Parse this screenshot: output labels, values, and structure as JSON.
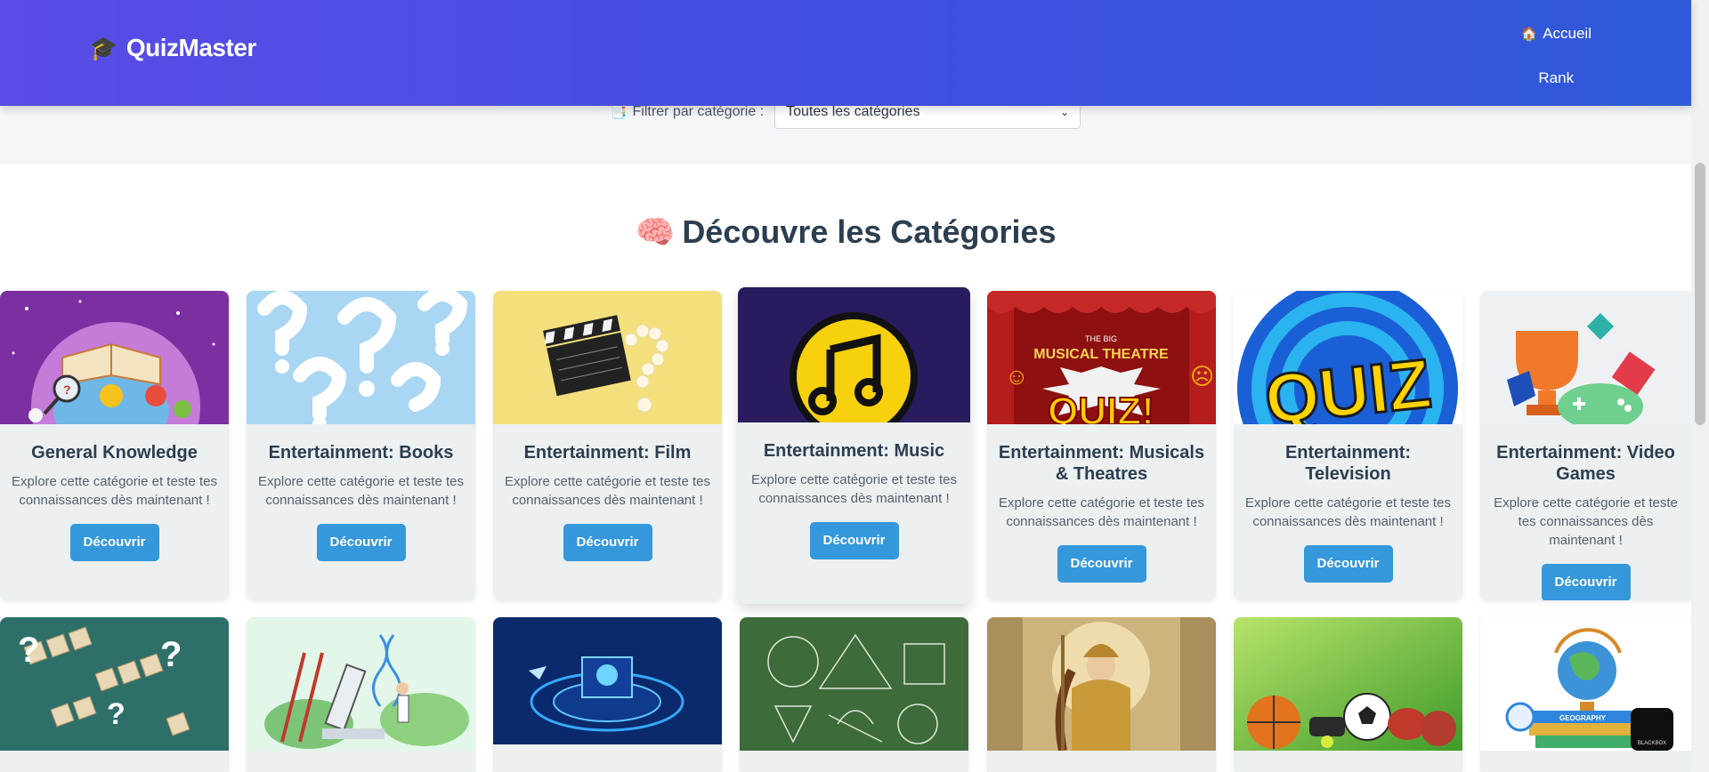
{
  "header": {
    "brand": "QuizMaster",
    "brand_icon": "graduation-cap-icon",
    "nav": [
      {
        "label": "Accueil",
        "icon": "house-icon"
      },
      {
        "label": "Rank"
      }
    ]
  },
  "filter": {
    "label": "Filtrer par catégorie :",
    "selected": "Toutes les catégories"
  },
  "section": {
    "title": "Découvre les Catégories",
    "icon": "brain-icon"
  },
  "cards": [
    {
      "title": "General Knowledge",
      "description": "Explore cette catégorie et teste tes connaissances dès maintenant !",
      "button": "Découvrir"
    },
    {
      "title": "Entertainment: Books",
      "description": "Explore cette catégorie et teste tes connaissances dès maintenant !",
      "button": "Découvrir"
    },
    {
      "title": "Entertainment: Film",
      "description": "Explore cette catégorie et teste tes connaissances dès maintenant !",
      "button": "Découvrir"
    },
    {
      "title": "Entertainment: Music",
      "description": "Explore cette catégorie et teste tes connaissances dès maintenant !",
      "button": "Découvrir"
    },
    {
      "title": "Entertainment: Musicals & Theatres",
      "description": "Explore cette catégorie et teste tes connaissances dès maintenant !",
      "button": "Découvrir"
    },
    {
      "title": "Entertainment: Television",
      "description": "Explore cette catégorie et teste tes connaissances dès maintenant !",
      "button": "Découvrir"
    },
    {
      "title": "Entertainment: Video Games",
      "description": "Explore cette catégorie et teste tes connaissances dès maintenant !",
      "button": "Découvrir"
    }
  ],
  "card_images": {
    "musical": {
      "line1": "THE BIG",
      "line2": "MUSICAL THEATRE",
      "line3": "QUIZ!"
    },
    "television": {
      "word": "QUIZ"
    },
    "geography": {
      "book_label": "GEOGRAPHY"
    }
  },
  "badge": {
    "label": "BLACKBOX"
  }
}
